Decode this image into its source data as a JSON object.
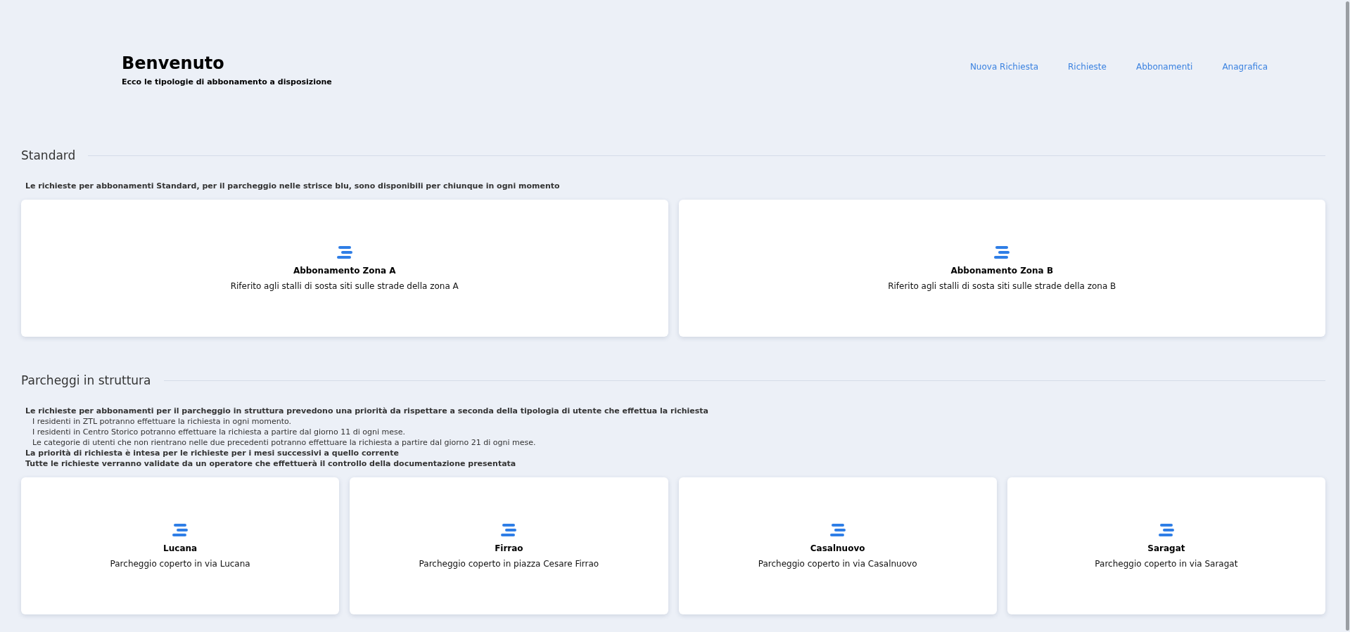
{
  "header": {
    "title": "Benvenuto",
    "subtitle": "Ecco le tipologie di abbonamento a disposizione"
  },
  "nav": [
    "Nuova Richiesta",
    "Richieste",
    "Abbonamenti",
    "Anagrafica"
  ],
  "sections": [
    {
      "title": "Standard",
      "notes": [
        {
          "kind": "bold",
          "text": "Le richieste per abbonamenti Standard, per il parcheggio nelle strisce blu, sono disponibili per chiunque in ogni momento"
        }
      ],
      "cards": [
        {
          "title": "Abbonamento Zona A",
          "description": "Riferito agli stalli di sosta siti sulle strade della zona A"
        },
        {
          "title": "Abbonamento Zona B",
          "description": "Riferito agli stalli di sosta siti sulle strade della zona B"
        }
      ]
    },
    {
      "title": "Parcheggi in struttura",
      "notes": [
        {
          "kind": "bold",
          "text": "Le richieste per abbonamenti per il parcheggio in struttura prevedono una priorità da rispettare a seconda della tipologia di utente che effettua la richiesta"
        },
        {
          "kind": "indent",
          "text": "I residenti in ZTL potranno effettuare la richiesta in ogni momento."
        },
        {
          "kind": "indent",
          "text": "I residenti in Centro Storico potranno effettuare la richiesta a partire dal giorno 11 di ogni mese."
        },
        {
          "kind": "indent",
          "text": "Le categorie di utenti che non rientrano nelle due precedenti potranno effettuare la richiesta a partire dal giorno 21 di ogni mese."
        },
        {
          "kind": "bold",
          "text": "La priorità di richiesta è intesa per le richieste per i mesi successivi a quello corrente"
        },
        {
          "kind": "bold",
          "text": "Tutte le richieste verranno validate da un operatore che effettuerà il controllo della documentazione presentata"
        }
      ],
      "cards": [
        {
          "title": "Lucana",
          "description": "Parcheggio coperto in via Lucana"
        },
        {
          "title": "Firrao",
          "description": "Parcheggio coperto in piazza Cesare Firrao"
        },
        {
          "title": "Casalnuovo",
          "description": "Parcheggio coperto in via Casalnuovo"
        },
        {
          "title": "Saragat",
          "description": "Parcheggio coperto in via Saragat"
        }
      ]
    }
  ]
}
